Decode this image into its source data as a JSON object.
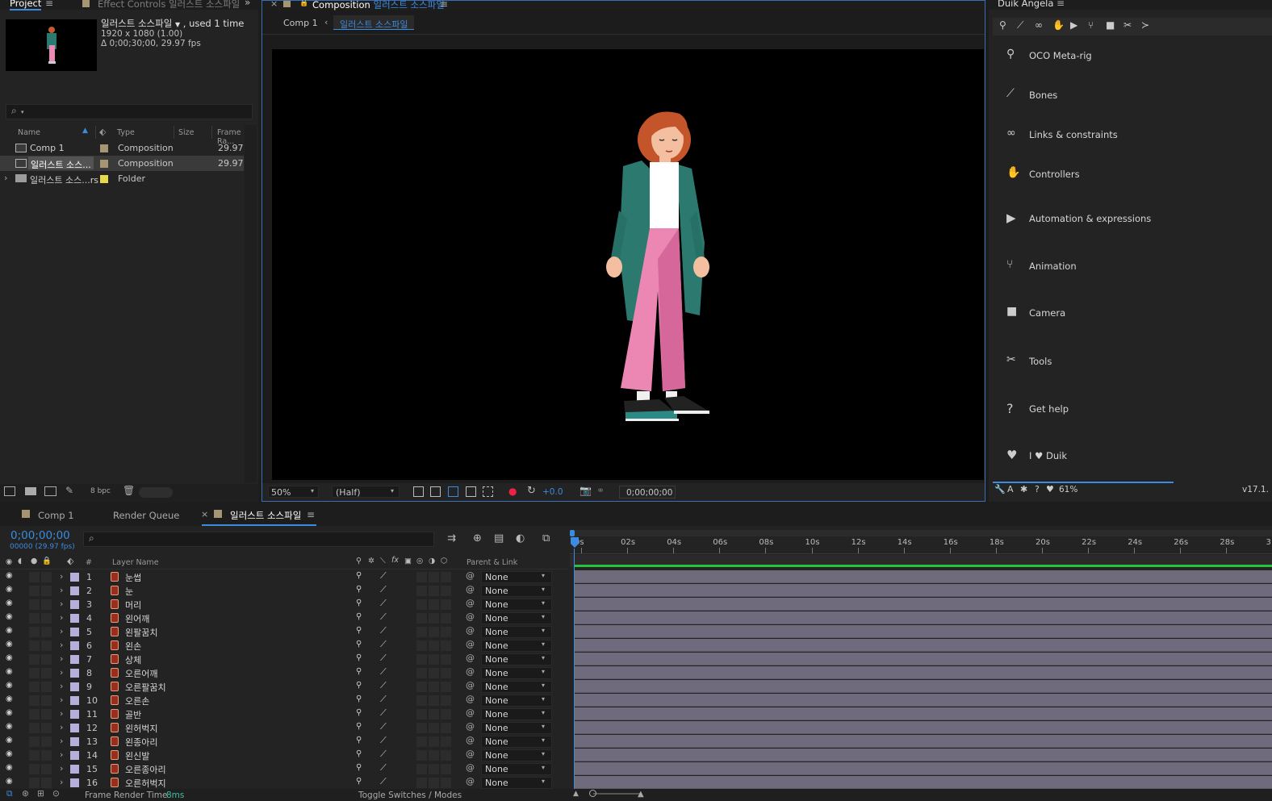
{
  "project_panel": {
    "tabs": [
      {
        "label": "Project"
      },
      {
        "label": "Effect Controls 일러스트 소스파일"
      }
    ],
    "info_name": "일러스트 소스파일",
    "info_used": ", used 1 time",
    "info_res": "1920 x 1080 (1.00)",
    "info_dur": "Δ 0;00;30;00, 29.97 fps",
    "search_placeholder": "",
    "columns": {
      "name": "Name",
      "type": "Type",
      "size": "Size",
      "framerate": "Frame Ra..."
    },
    "items": [
      {
        "name": "Comp 1",
        "type": "Composition",
        "size": "",
        "fps": "29.97",
        "color": "#a59573"
      },
      {
        "name": "일러스트 소스...",
        "type": "Composition",
        "size": "",
        "fps": "29.97",
        "color": "#a59573"
      },
      {
        "name": "일러스트 소스...rs",
        "type": "Folder",
        "size": "",
        "fps": "",
        "color": "#e8d84a"
      }
    ],
    "bpc": "8 bpc"
  },
  "viewer": {
    "tab_prefix": "Composition",
    "tab_name": "일러스트 소스파일",
    "breadcrumb_1": "Comp 1",
    "breadcrumb_2": "일러스트 소스파일",
    "zoom": "50%",
    "resolution": "(Half)",
    "exposure": "+0.0",
    "timecode": "0;00;00;00"
  },
  "duik": {
    "title": "Duik Angela",
    "items": [
      {
        "label": "OCO Meta-rig",
        "icon": "meta-rig-icon"
      },
      {
        "label": "Bones",
        "icon": "bone-icon"
      },
      {
        "label": "Links & constraints",
        "icon": "link-icon"
      },
      {
        "label": "Controllers",
        "icon": "hand-icon"
      },
      {
        "label": "Automation & expressions",
        "icon": "play-icon"
      },
      {
        "label": "Animation",
        "icon": "animation-icon"
      },
      {
        "label": "Camera",
        "icon": "camera-icon"
      },
      {
        "label": "Tools",
        "icon": "tools-icon"
      },
      {
        "label": "Get help",
        "icon": "help-icon"
      },
      {
        "label": "I ♥ Duik",
        "icon": "heart-icon"
      }
    ],
    "percent": "61%",
    "version": "v17.1."
  },
  "timeline": {
    "tabs": [
      {
        "label": "Comp 1"
      },
      {
        "label": "Render Queue"
      },
      {
        "label": "일러스트 소스파일"
      }
    ],
    "timecode": "0;00;00;00",
    "frames": "00000 (29.97 fps)",
    "col_num": "#",
    "col_layer": "Layer Name",
    "col_parent": "Parent & Link",
    "ruler": [
      "0s",
      "02s",
      "04s",
      "06s",
      "08s",
      "10s",
      "12s",
      "14s",
      "16s",
      "18s",
      "20s",
      "22s",
      "24s",
      "26s",
      "28s",
      "3"
    ],
    "layers": [
      {
        "num": "1",
        "name": "눈썹",
        "parent": "None"
      },
      {
        "num": "2",
        "name": "눈",
        "parent": "None"
      },
      {
        "num": "3",
        "name": "머리",
        "parent": "None"
      },
      {
        "num": "4",
        "name": "왼어깨",
        "parent": "None"
      },
      {
        "num": "5",
        "name": "왼팔꿈치",
        "parent": "None"
      },
      {
        "num": "6",
        "name": "왼손",
        "parent": "None"
      },
      {
        "num": "7",
        "name": "상체",
        "parent": "None"
      },
      {
        "num": "8",
        "name": "오른어깨",
        "parent": "None"
      },
      {
        "num": "9",
        "name": "오른팔꿈치",
        "parent": "None"
      },
      {
        "num": "10",
        "name": "오른손",
        "parent": "None"
      },
      {
        "num": "11",
        "name": "골반",
        "parent": "None"
      },
      {
        "num": "12",
        "name": "왼허벅지",
        "parent": "None"
      },
      {
        "num": "13",
        "name": "왼종아리",
        "parent": "None"
      },
      {
        "num": "14",
        "name": "왼신발",
        "parent": "None"
      },
      {
        "num": "15",
        "name": "오른종아리",
        "parent": "None"
      },
      {
        "num": "16",
        "name": "오른허벅지",
        "parent": "None"
      }
    ],
    "footer_label": "Frame Render Time",
    "footer_value": "8ms",
    "toggle_label": "Toggle Switches / Modes"
  },
  "colors": {
    "accent": "#3b8be0",
    "layer_label": "#b7aedb",
    "bar": "#6f6b7c",
    "work_area": "#27c33c"
  }
}
